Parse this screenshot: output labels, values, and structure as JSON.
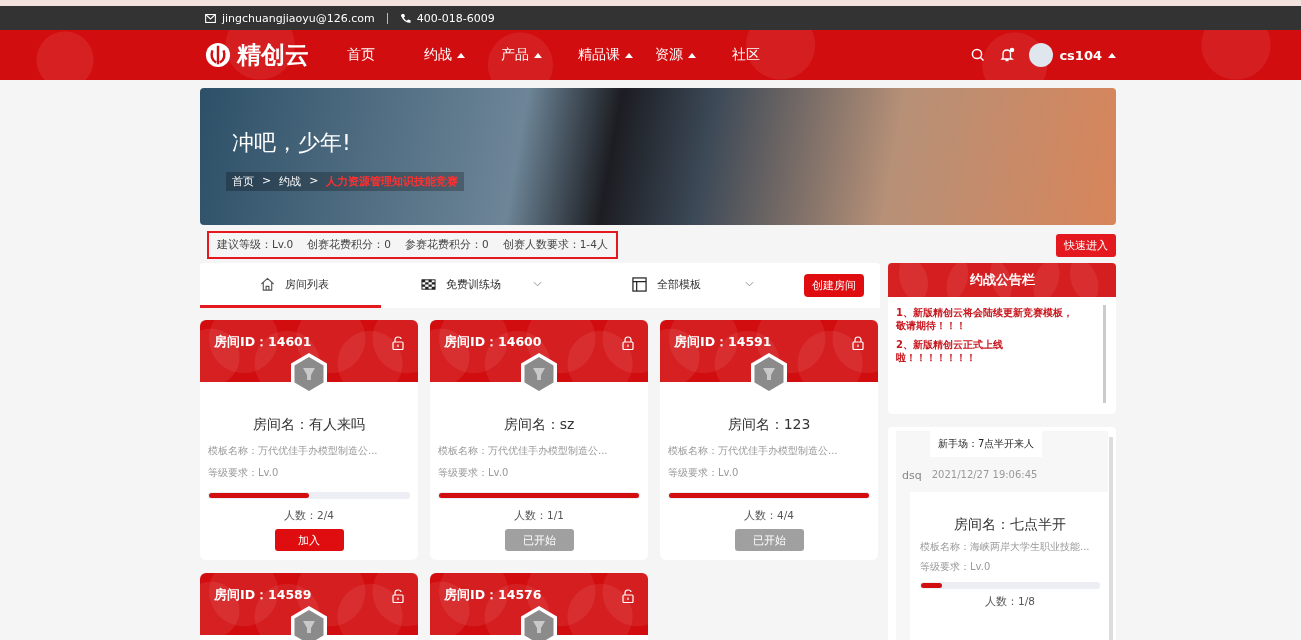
{
  "contact": {
    "email": "jingchuangjiaoyu@126.com",
    "phone": "400-018-6009"
  },
  "nav": {
    "logo": "精创云",
    "items": [
      {
        "label": "首页",
        "has_menu": false
      },
      {
        "label": "约战",
        "has_menu": true
      },
      {
        "label": "产品",
        "has_menu": true
      },
      {
        "label": "精品课",
        "has_menu": true
      },
      {
        "label": "资源",
        "has_menu": true
      },
      {
        "label": "社区",
        "has_menu": false
      }
    ],
    "has_notification": true,
    "user": "cs104"
  },
  "banner": {
    "title": "冲吧，少年!",
    "breadcrumb": [
      {
        "label": "首页",
        "current": false
      },
      {
        "label": "约战",
        "current": false,
        "separator": ">"
      },
      {
        "label": "人力资源管理知识技能竞赛",
        "current": true,
        "separator": ">"
      }
    ]
  },
  "requirements": {
    "outlined": true,
    "items": [
      "建议等级：Lv.0",
      "创赛花费积分：0",
      "参赛花费积分：0",
      "创赛人数要求：1-4人"
    ]
  },
  "quick_enter": "快速进入",
  "tabs": [
    {
      "kind": "home",
      "label": "房间列表",
      "selected": true,
      "dropdown": false
    },
    {
      "kind": "flag",
      "label": "免费训练场",
      "selected": false,
      "dropdown": true
    },
    {
      "kind": "layout",
      "label": "全部模板",
      "selected": false,
      "dropdown": true
    }
  ],
  "create_button": "创建房间",
  "rooms": [
    {
      "id": "房间ID：14601",
      "locked": false,
      "name": "房间名：有人来吗",
      "template": "模板名称：万代优佳手办模型制造公...",
      "level_req": "等级要求：Lv.0",
      "level": 0.5,
      "players": "人数：2/4",
      "action": {
        "kind": "join",
        "label": "加入"
      }
    },
    {
      "id": "房间ID：14600",
      "locked": true,
      "name": "房间名：sz",
      "template": "模板名称：万代优佳手办模型制造公...",
      "level_req": "等级要求：Lv.0",
      "level": 1,
      "players": "人数：1/1",
      "action": {
        "kind": "started",
        "label": "已开始"
      }
    },
    {
      "id": "房间ID：14591",
      "locked": true,
      "name": "房间名：123",
      "template": "模板名称：万代优佳手办模型制造公...",
      "level_req": "等级要求：Lv.0",
      "level": 1,
      "players": "人数：4/4",
      "action": {
        "kind": "started",
        "label": "已开始"
      }
    },
    {
      "id": "房间ID：14589",
      "locked": false
    },
    {
      "id": "房间ID：14576",
      "locked": false
    }
  ],
  "notice": {
    "title": "约战公告栏",
    "items": [
      "1、新版精创云将会陆续更新竞赛模板，敬请期待！！！",
      "2、新版精创云正式上线啦！！！！！！！"
    ]
  },
  "chat": {
    "message": "新手场：7点半开来人",
    "user": "dsq",
    "time": "2021/12/27 19:06:45",
    "room": {
      "name": "房间名：七点半开",
      "template": "模板名称：海峡两岸大学生职业技能...",
      "level_req": "等级要求：Lv.0",
      "level": 0.12,
      "players": "人数：1/8"
    }
  }
}
